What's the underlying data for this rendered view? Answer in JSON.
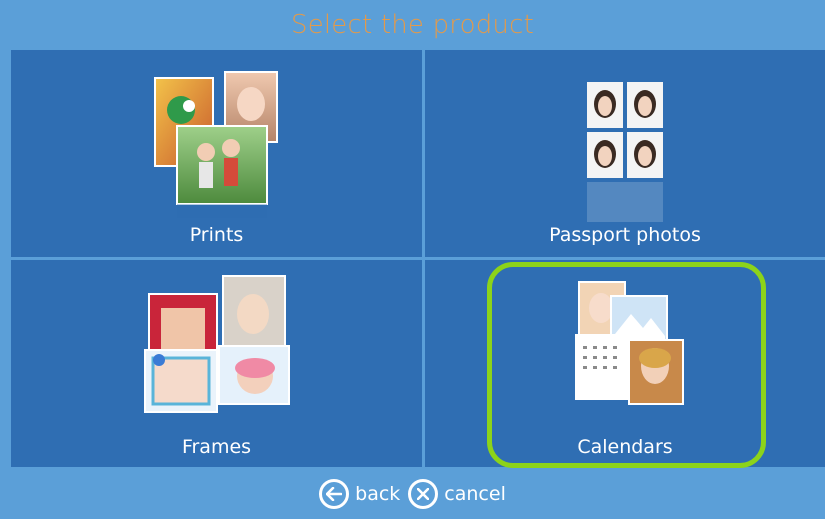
{
  "header": {
    "title": "Select the product"
  },
  "tiles": [
    {
      "label": "Prints"
    },
    {
      "label": "Passport photos"
    },
    {
      "label": "Frames"
    },
    {
      "label": "Calendars",
      "selected": true
    }
  ],
  "footer": {
    "back_label": "back",
    "cancel_label": "cancel"
  },
  "colors": {
    "tile": "#2f6eb3",
    "background": "#5b9fd8",
    "title": "#e39a4a",
    "highlight": "#8cd31a"
  },
  "icons": {
    "back": "back-arrow-icon",
    "cancel": "cancel-x-icon"
  }
}
